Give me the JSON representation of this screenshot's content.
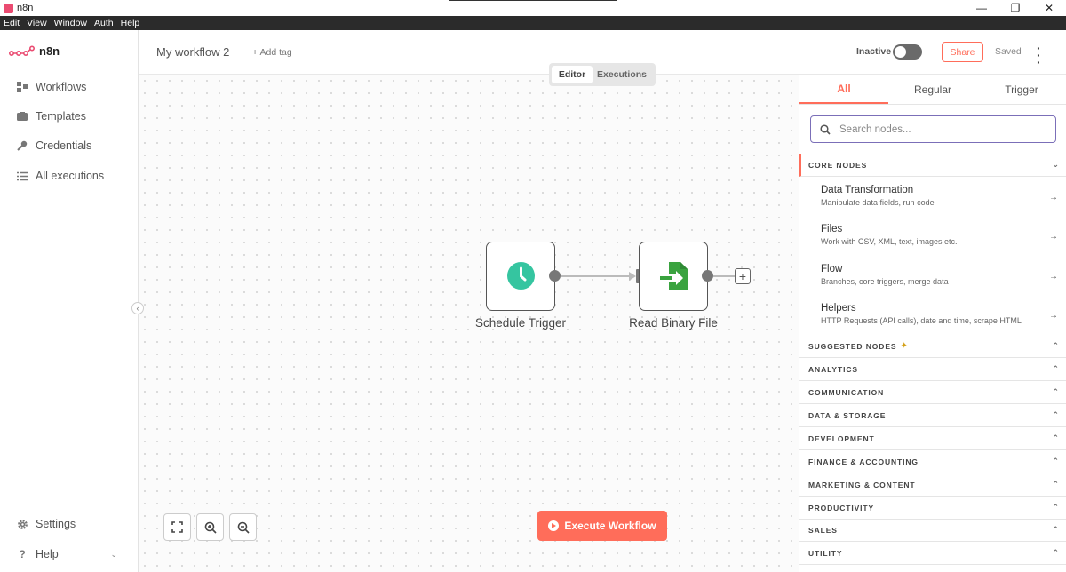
{
  "window": {
    "title": "n8n",
    "controls": {
      "minimize": "—",
      "maximize": "❐",
      "close": "✕"
    }
  },
  "menubar": [
    "Edit",
    "View",
    "Window",
    "Auth",
    "Help"
  ],
  "sidebar": {
    "logo_text": "n8n",
    "items": [
      {
        "label": "Workflows",
        "icon": "workflows-icon"
      },
      {
        "label": "Templates",
        "icon": "templates-icon"
      },
      {
        "label": "Credentials",
        "icon": "key-icon"
      },
      {
        "label": "All executions",
        "icon": "list-icon"
      }
    ],
    "bottom": [
      {
        "label": "Settings",
        "icon": "gear-icon"
      },
      {
        "label": "Help",
        "icon": "help-icon"
      }
    ]
  },
  "header": {
    "workflow_name": "My workflow 2",
    "add_tag": "+ Add tag",
    "status_label": "Inactive",
    "share_label": "Share",
    "saved_label": "Saved"
  },
  "canvas": {
    "modes": [
      "Editor",
      "Executions"
    ],
    "active_mode": "Editor",
    "nodes": [
      {
        "label": "Schedule Trigger",
        "icon": "clock-icon"
      },
      {
        "label": "Read Binary File",
        "icon": "file-import-icon"
      }
    ],
    "execute_label": "Execute Workflow"
  },
  "panel": {
    "tabs": [
      "All",
      "Regular",
      "Trigger"
    ],
    "active_tab": "All",
    "search_placeholder": "Search nodes...",
    "core_header": "CORE NODES",
    "core_items": [
      {
        "title": "Data Transformation",
        "desc": "Manipulate data fields, run code"
      },
      {
        "title": "Files",
        "desc": "Work with CSV, XML, text, images etc."
      },
      {
        "title": "Flow",
        "desc": "Branches, core triggers, merge data"
      },
      {
        "title": "Helpers",
        "desc": "HTTP Requests (API calls), date and time, scrape HTML"
      }
    ],
    "sections": [
      "SUGGESTED NODES",
      "ANALYTICS",
      "COMMUNICATION",
      "DATA & STORAGE",
      "DEVELOPMENT",
      "FINANCE & ACCOUNTING",
      "MARKETING & CONTENT",
      "PRODUCTIVITY",
      "SALES",
      "UTILITY"
    ]
  },
  "colors": {
    "accent": "#ff6d5a",
    "brand": "#ea4b71",
    "trigger_green": "#35c5a0",
    "file_green": "#3aa33f"
  }
}
